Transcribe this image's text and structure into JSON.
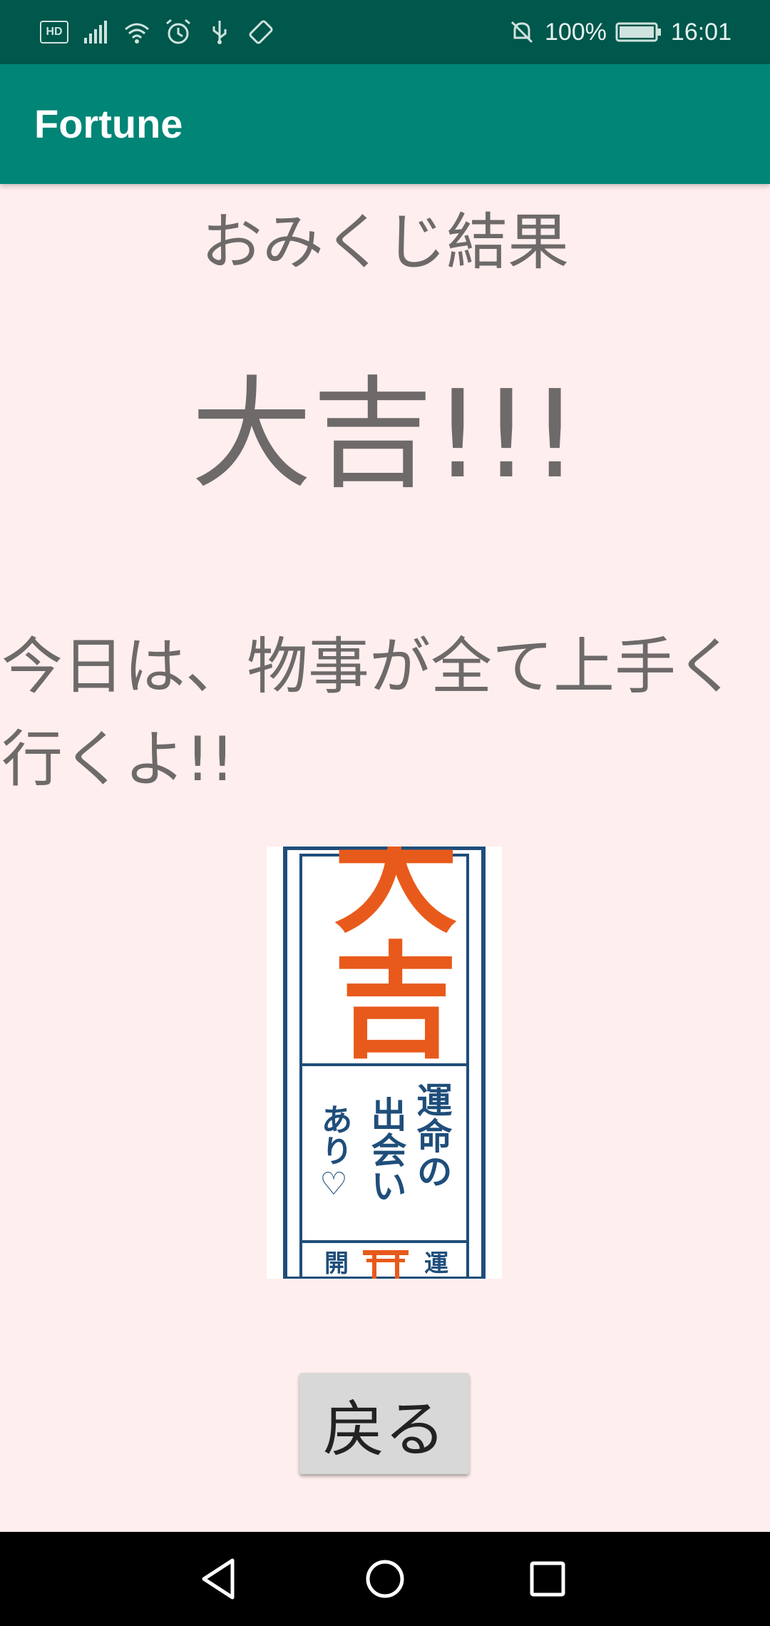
{
  "status_bar": {
    "hd_label": "HD",
    "battery_percent": "100%",
    "time": "16:01"
  },
  "app_bar": {
    "title": "Fortune"
  },
  "content": {
    "heading": "おみくじ結果",
    "result": "大吉!!!",
    "message": "今日は、物事が全て上手く行くよ!!",
    "omikuji_card": {
      "top_text": "大吉",
      "right_column": "運命の",
      "middle_column": "出会い",
      "left_column": "あり♡",
      "bottom_left": "開",
      "bottom_right": "運"
    },
    "back_button_label": "戻る"
  },
  "colors": {
    "status_bar": "#00574B",
    "app_bar": "#008577",
    "background": "#FFEEEE",
    "text": "#6E6A6A",
    "card_orange": "#E85A1B",
    "card_blue": "#1F4E7A"
  }
}
